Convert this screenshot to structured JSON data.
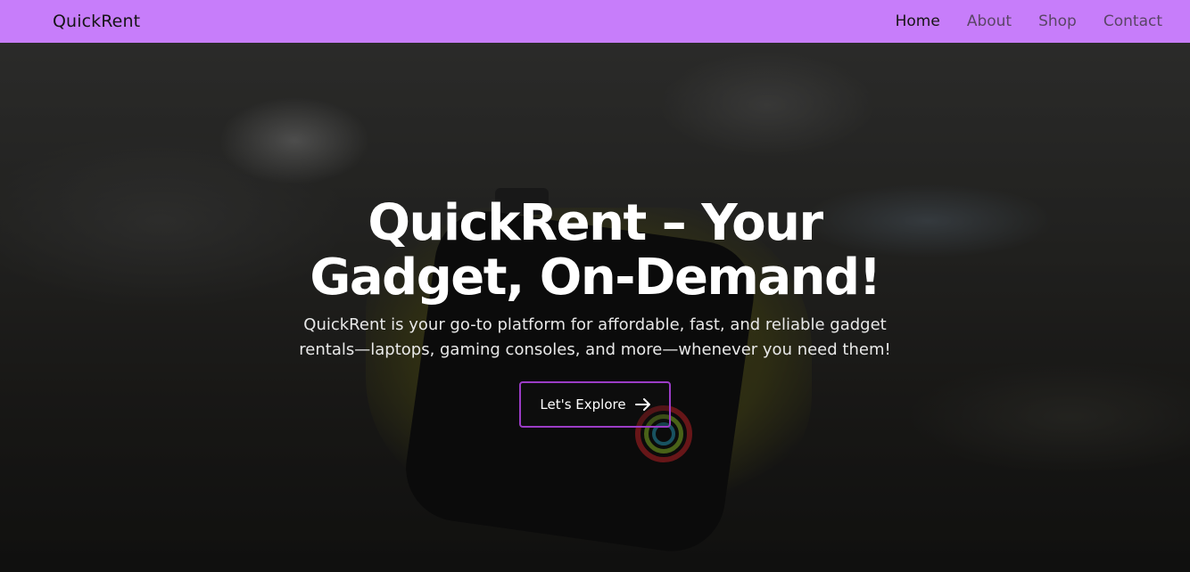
{
  "brand": "QuickRent",
  "nav": {
    "items": [
      {
        "label": "Home",
        "active": true
      },
      {
        "label": "About",
        "active": false
      },
      {
        "label": "Shop",
        "active": false
      },
      {
        "label": "Contact",
        "active": false
      }
    ]
  },
  "hero": {
    "title": "QuickRent – Your Gadget, On-Demand!",
    "description": "QuickRent is your go-to platform for affordable, fast, and reliable gadget rentals—laptops, gaming consoles, and more—whenever you need them!",
    "cta_label": "Let's Explore",
    "cta_icon": "arrow-right-icon"
  },
  "colors": {
    "navbar_bg": "#c77dfa",
    "cta_border": "#9b3cc6"
  }
}
